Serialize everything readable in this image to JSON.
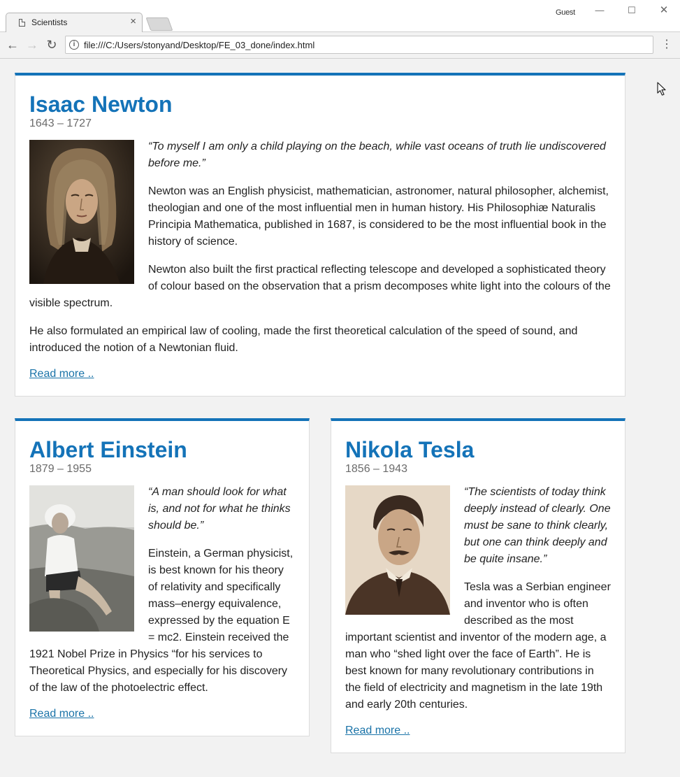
{
  "browser": {
    "tab_title": "Scientists",
    "tab_close": "×",
    "profile_label": "Guest",
    "window_minimize": "—",
    "window_maximize": "☐",
    "window_close": "✕",
    "back": "←",
    "forward": "→",
    "reload": "↻",
    "info": "i",
    "url": "file:///C:/Users/stonyand/Desktop/FE_03_done/index.html",
    "menu": "⋮"
  },
  "scientists": {
    "newton": {
      "name": "Isaac Newton",
      "years": "1643 – 1727",
      "quote": "“To myself I am only a child playing on the beach, while vast oceans of truth lie undiscovered before me.”",
      "paragraphs": [
        "Newton was an English physicist, mathematician, astronomer, natural philosopher, alchemist, theologian and one of the most influential men in human history. His Philosophiæ Naturalis Principia Mathematica, published in 1687, is considered to be the most influential book in the history of science.",
        "Newton also built the first practical reflecting telescope and developed a sophisticated theory of colour based on the observation that a prism decomposes white light into the colours of the visible spectrum.",
        "He also formulated an empirical law of cooling, made the first theoretical calculation of the speed of sound, and introduced the notion of a Newtonian fluid."
      ],
      "read_more": "Read more .."
    },
    "einstein": {
      "name": "Albert Einstein",
      "years": "1879 – 1955",
      "quote": "“A man should look for what is, and not for what he thinks should be.”",
      "paragraphs": [
        "Einstein, a German physicist, is best known for his theory of relativity and specifically mass–energy equivalence, expressed by the equation E = mc2. Einstein received the 1921 Nobel Prize in Physics “for his services to Theoretical Physics, and especially for his discovery of the law of the photoelectric effect."
      ],
      "read_more": "Read more .."
    },
    "tesla": {
      "name": "Nikola Tesla",
      "years": "1856 – 1943",
      "quote": "“The scientists of today think deeply instead of clearly. One must be sane to think clearly, but one can think deeply and be quite insane.”",
      "paragraphs": [
        "Tesla was a Serbian engineer and inventor who is often described as the most important scientist and inventor of the modern age, a man who “shed light over the face of Earth”. He is best known for many revolutionary contributions in the field of electricity and magnetism in the late 19th and early 20th centuries."
      ],
      "read_more": "Read more .."
    }
  },
  "colors": {
    "accent": "#1473b8",
    "link": "#1a73a8",
    "years_text": "#6b6b6b",
    "page_bg": "#f2f2f2"
  }
}
